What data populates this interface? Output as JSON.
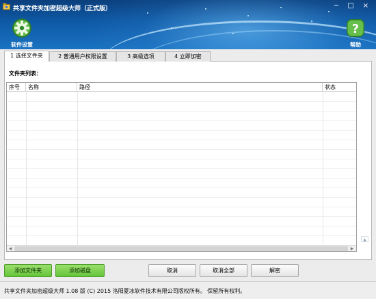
{
  "window": {
    "title": "共享文件夹加密超级大师（正式版）",
    "controls": {
      "minimize": "−",
      "maximize": "□",
      "close": "×"
    }
  },
  "toolbar": {
    "settings": {
      "label": "软件设置",
      "icon": "gear-icon"
    },
    "help": {
      "label": "帮助",
      "icon": "help-icon"
    }
  },
  "tabs": [
    {
      "label": "1 选择文件夹",
      "active": true
    },
    {
      "label": "2 普通用户权限设置",
      "active": false
    },
    {
      "label": "3 高级选项",
      "active": false
    },
    {
      "label": "4 立即加密",
      "active": false
    }
  ],
  "main": {
    "list_label": "文件夹列表：",
    "columns": [
      "序号",
      "名称",
      "路径",
      "状态"
    ]
  },
  "buttons": {
    "add_folder": "添加文件夹",
    "add_disk": "添加磁盘",
    "cancel": "取消",
    "cancel_all": "取消全部",
    "decrypt": "解密"
  },
  "status_bar": {
    "text": "共享文件夹加密超级大师 1.08 版 (C) 2015 洛阳夏冰软件技术有限公司版权所有。 保留所有权利。"
  },
  "colors": {
    "header_dark": "#0b3f7c",
    "header_light": "#1a73c2",
    "green_button": "#64c33a",
    "panel_bg": "#ffffff",
    "window_bg": "#ececec"
  }
}
